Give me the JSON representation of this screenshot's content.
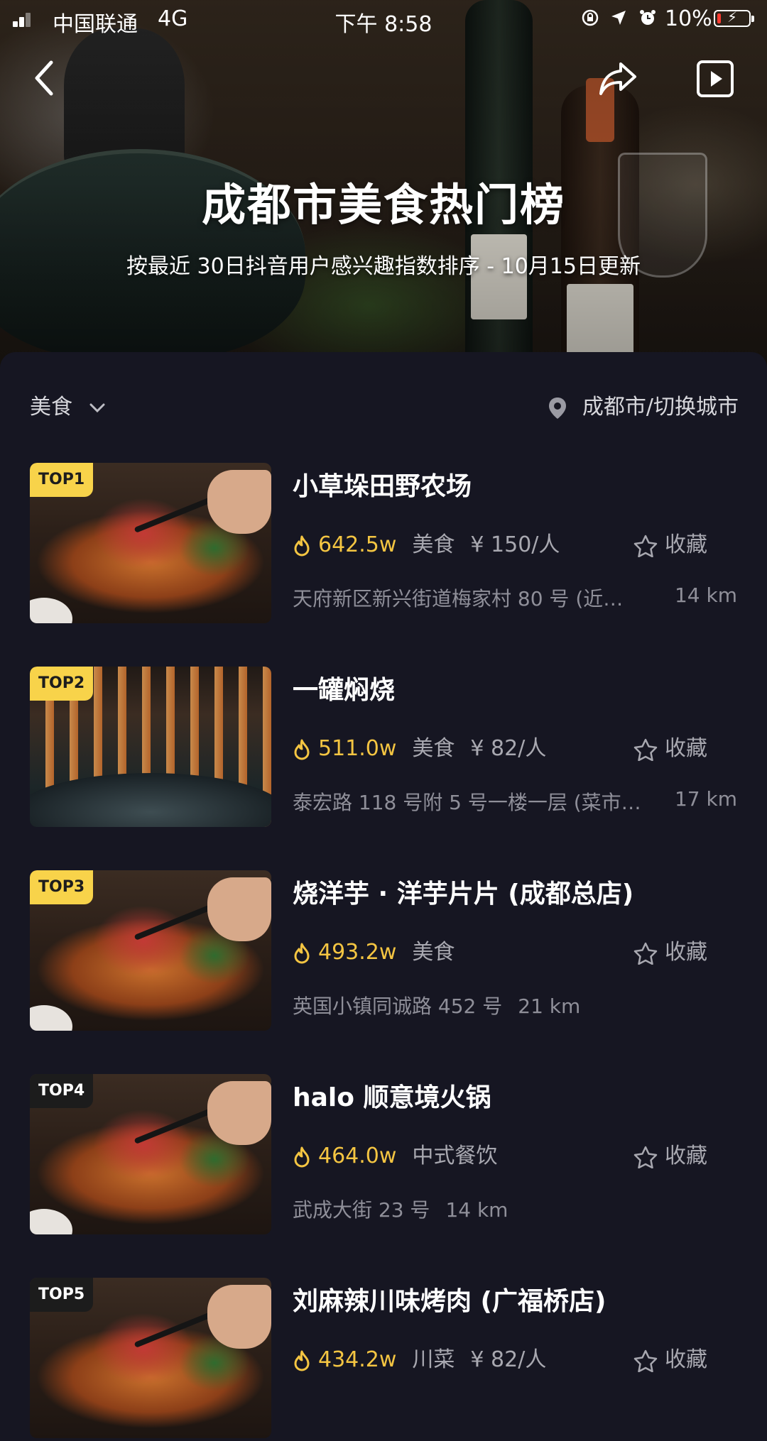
{
  "status_bar": {
    "carrier": "中国联通",
    "network": "4G",
    "time": "下午 8:58",
    "battery": "10%"
  },
  "header": {
    "title": "成都市美食热门榜",
    "subtitle": "按最近 30日抖音用户感兴趣指数排序 - 10月15日更新"
  },
  "filter": {
    "category": "美食",
    "city": "成都市/切换城市"
  },
  "favorite_label": "收藏",
  "items": [
    {
      "rank": "TOP1",
      "name": "小草垛田野农场",
      "heat": "642.5w",
      "category": "美食",
      "price": "¥ 150/人",
      "address": "天府新区新兴街道梅家村 80 号 (近…",
      "distance": "14 km"
    },
    {
      "rank": "TOP2",
      "name": "一罐焖烧",
      "heat": "511.0w",
      "category": "美食",
      "price": "¥ 82/人",
      "address": "泰宏路 118 号附 5 号一楼一层 (菜市…",
      "distance": "17 km"
    },
    {
      "rank": "TOP3",
      "name": "烧洋芋 · 洋芋片片 (成都总店)",
      "heat": "493.2w",
      "category": "美食",
      "price": "",
      "address": "英国小镇同诚路 452 号",
      "distance": "21 km"
    },
    {
      "rank": "TOP4",
      "name": "halo 顺意境火锅",
      "heat": "464.0w",
      "category": "中式餐饮",
      "price": "",
      "address": "武成大街 23 号",
      "distance": "14 km"
    },
    {
      "rank": "TOP5",
      "name": "刘麻辣川味烤肉 (广福桥店)",
      "heat": "434.2w",
      "category": "川菜",
      "price": "¥ 82/人",
      "address": "",
      "distance": ""
    }
  ],
  "colors": {
    "background": "#161622",
    "heat": "#f4c542",
    "badge_gold": "#f8d34a",
    "badge_dark": "#1c1c1c"
  },
  "icons": [
    "back-icon",
    "share-icon",
    "play-icon",
    "chevron-down-icon",
    "location-pin-icon",
    "flame-icon",
    "star-icon"
  ]
}
